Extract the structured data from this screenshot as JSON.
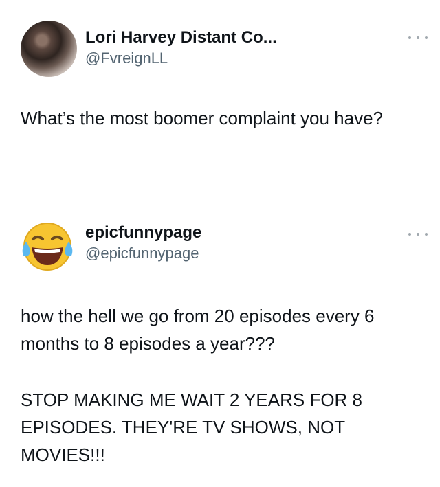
{
  "tweets": [
    {
      "display_name": "Lori Harvey Distant Co...",
      "handle": "@FvreignLL",
      "text": "What’s the most boomer complaint you have?",
      "more_icon": "more-dots-icon"
    },
    {
      "display_name": "epicfunnypage",
      "handle": "@epicfunnypage",
      "text_1": "how the hell we go from 20 episodes every 6 months to 8 episodes a year???",
      "text_2": "STOP MAKING ME WAIT 2 YEARS FOR 8 EPISODES. THEY'RE TV SHOWS, NOT MOVIES!!!",
      "avatar_icon": "laughing-tears-emoji-icon",
      "more_icon": "more-dots-icon"
    }
  ]
}
